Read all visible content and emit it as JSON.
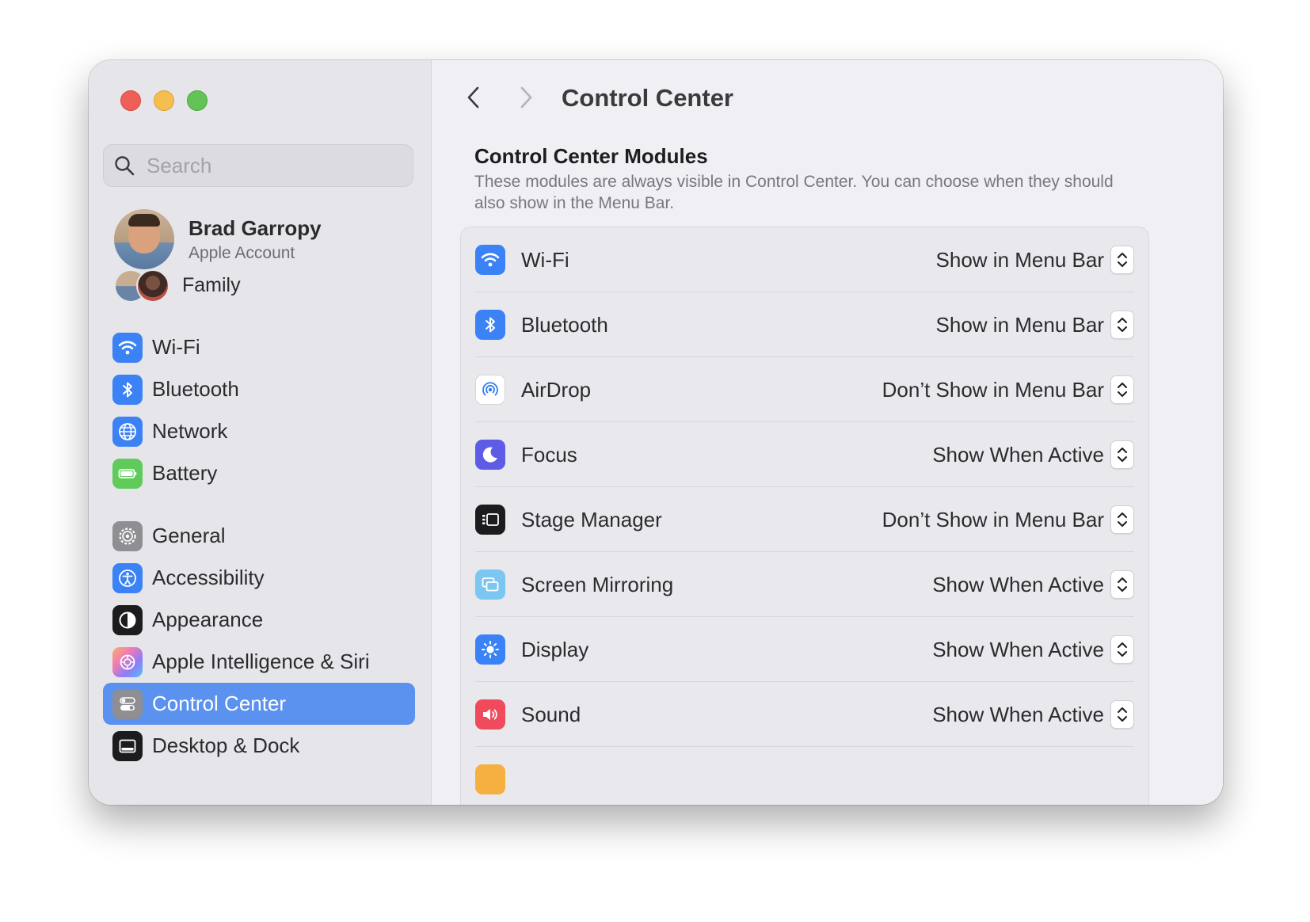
{
  "window": {
    "title": "Control Center"
  },
  "sidebar": {
    "search": {
      "placeholder": "Search",
      "value": ""
    },
    "account": {
      "name": "Brad Garropy",
      "subtitle": "Apple Account"
    },
    "family": {
      "label": "Family"
    },
    "groups": [
      [
        {
          "label": "Wi-Fi",
          "icon": "wifi-icon",
          "color": "#3b82f6"
        },
        {
          "label": "Bluetooth",
          "icon": "bluetooth-icon",
          "color": "#3b82f6"
        },
        {
          "label": "Network",
          "icon": "globe-icon",
          "color": "#3b82f6"
        },
        {
          "label": "Battery",
          "icon": "battery-icon",
          "color": "#5fcb5a"
        }
      ],
      [
        {
          "label": "General",
          "icon": "gear-icon",
          "color": "#8e8e93"
        },
        {
          "label": "Accessibility",
          "icon": "accessibility-icon",
          "color": "#3b82f6"
        },
        {
          "label": "Appearance",
          "icon": "appearance-icon",
          "color": "#1c1c1e"
        },
        {
          "label": "Apple Intelligence & Siri",
          "icon": "siri-icon",
          "color": "#f4a3c6"
        },
        {
          "label": "Control Center",
          "icon": "switches-icon",
          "color": "#8e8e93",
          "selected": true
        },
        {
          "label": "Desktop & Dock",
          "icon": "dock-icon",
          "color": "#1c1c1e"
        }
      ]
    ]
  },
  "main": {
    "title": "Control Center",
    "section_title": "Control Center Modules",
    "section_description": "These modules are always visible in Control Center. You can choose when they should also show in the Menu Bar.",
    "modules": [
      {
        "name": "Wi-Fi",
        "value": "Show in Menu Bar",
        "icon": "wifi-icon",
        "color": "#3b82f6"
      },
      {
        "name": "Bluetooth",
        "value": "Show in Menu Bar",
        "icon": "bluetooth-icon",
        "color": "#3b82f6"
      },
      {
        "name": "AirDrop",
        "value": "Don’t Show in Menu Bar",
        "icon": "airdrop-icon",
        "color": "#ffffff"
      },
      {
        "name": "Focus",
        "value": "Show When Active",
        "icon": "moon-icon",
        "color": "#5e5ce6"
      },
      {
        "name": "Stage Manager",
        "value": "Don’t Show in Menu Bar",
        "icon": "stage-manager-icon",
        "color": "#1c1c1e"
      },
      {
        "name": "Screen Mirroring",
        "value": "Show When Active",
        "icon": "screen-mirroring-icon",
        "color": "#7cc6f2"
      },
      {
        "name": "Display",
        "value": "Show When Active",
        "icon": "sun-icon",
        "color": "#3b82f6"
      },
      {
        "name": "Sound",
        "value": "Show When Active",
        "icon": "speaker-icon",
        "color": "#ef4b5c"
      }
    ]
  }
}
